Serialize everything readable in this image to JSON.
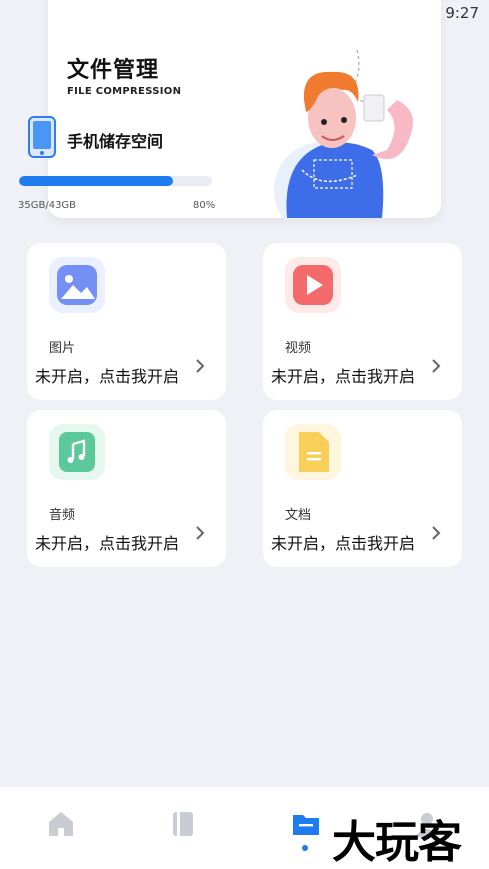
{
  "status_bar": {
    "time": "9:27",
    "icons": [
      "wifi-icon",
      "no-sim-icon",
      "battery-charging-icon"
    ]
  },
  "header": {
    "title": "文件管理",
    "subtitle": "FILE COMPRESSION",
    "storage_label": "手机储存空间",
    "storage_used": "35GB/43GB",
    "storage_percent": "80%",
    "storage_fraction": 0.8,
    "progress_color": "#1f7cf0"
  },
  "categories": [
    {
      "label": "图片",
      "status": "未开启，点击我开启",
      "icon": "image-icon",
      "color": "#6f8cf5"
    },
    {
      "label": "视频",
      "status": "未开启，点击我开启",
      "icon": "play-icon",
      "color": "#f46a6a"
    },
    {
      "label": "音频",
      "status": "未开启，点击我开启",
      "icon": "music-icon",
      "color": "#5cc99a"
    },
    {
      "label": "文档",
      "status": "未开启，点击我开启",
      "icon": "document-icon",
      "color": "#f7cf59"
    }
  ],
  "bottom_nav": {
    "items": [
      "home-icon",
      "book-icon",
      "folder-icon",
      "profile-icon"
    ],
    "active_index": 2,
    "active_color": "#1f7cf0",
    "inactive_color": "#c9ccd3"
  },
  "watermark": "大玩客"
}
